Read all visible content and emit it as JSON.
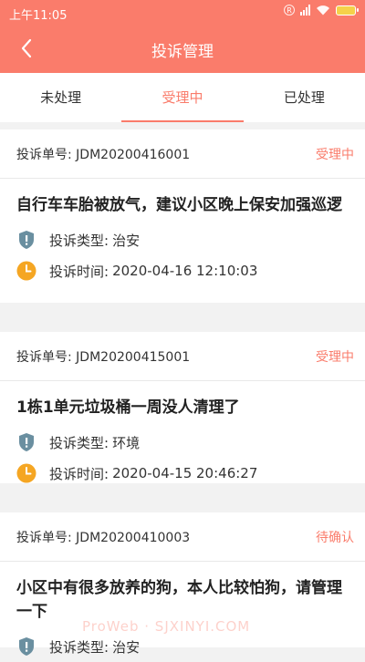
{
  "status_bar": {
    "time": "上午11:05",
    "r_badge": "R"
  },
  "header": {
    "title": "投诉管理"
  },
  "tabs": [
    {
      "label": "未处理",
      "active": false
    },
    {
      "label": "受理中",
      "active": true
    },
    {
      "label": "已处理",
      "active": false
    }
  ],
  "labels": {
    "order_prefix": "投诉单号: ",
    "type_label": "投诉类型:",
    "time_label": "投诉时间:"
  },
  "complaints": [
    {
      "order_no": "JDM20200416001",
      "status": "受理中",
      "title": "自行车车胎被放气，建议小区晚上保安加强巡逻",
      "type": "治安",
      "time": "2020-04-16 12:10:03"
    },
    {
      "order_no": "JDM20200415001",
      "status": "受理中",
      "title": "1栋1单元垃圾桶一周没人清理了",
      "type": "环境",
      "time": "2020-04-15 20:46:27"
    },
    {
      "order_no": "JDM20200410003",
      "status": "待确认",
      "title": "小区中有很多放养的狗，本人比较怕狗，请管理一下",
      "type": "治安",
      "time": ""
    }
  ],
  "watermark": "ProWeb · SJXINYI.COM",
  "colors": {
    "accent": "#fa7c6b",
    "shield": "#6a8fa0",
    "clock": "#f5a623"
  }
}
